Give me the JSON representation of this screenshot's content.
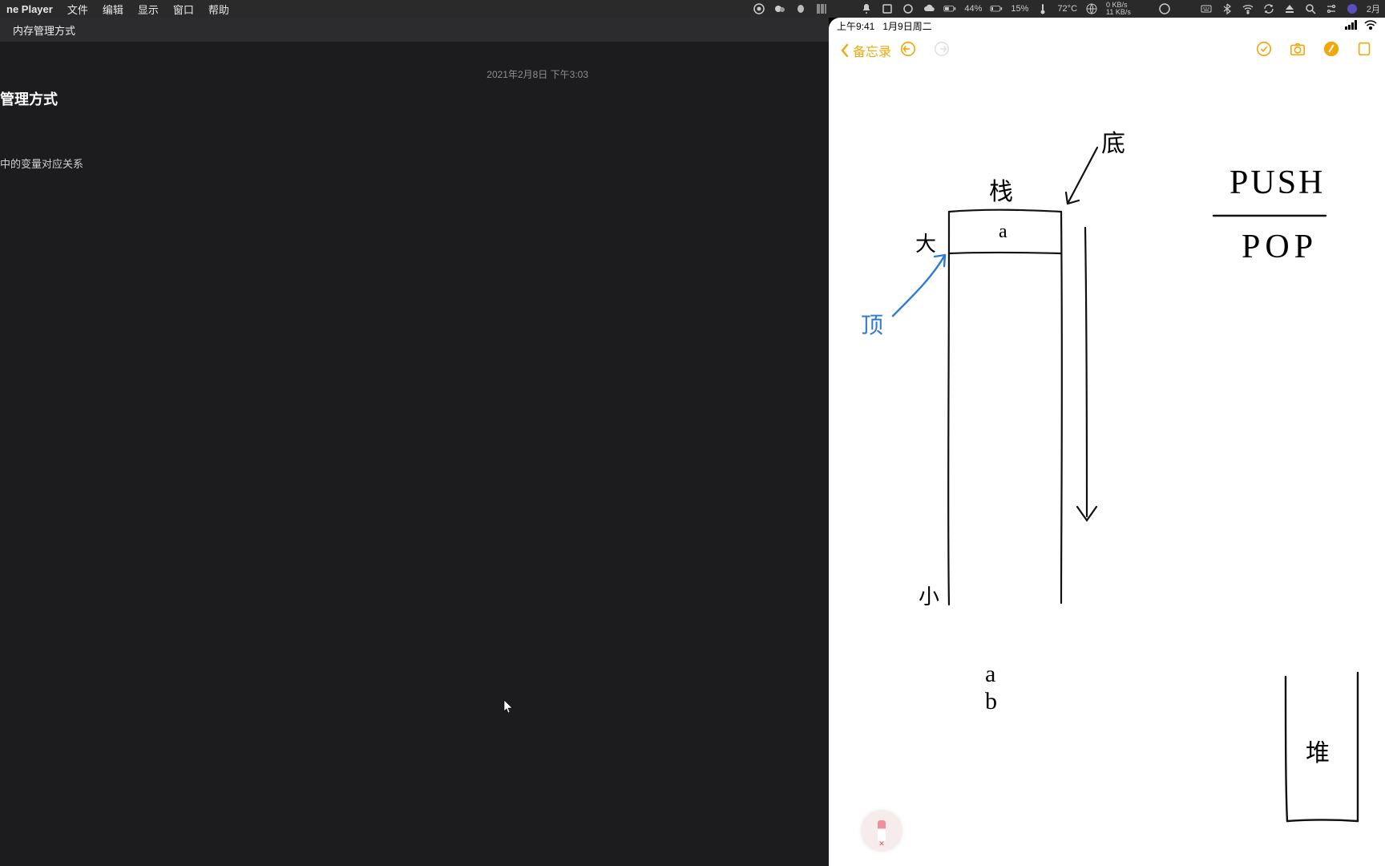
{
  "menubar": {
    "app": "ne Player",
    "items": [
      "文件",
      "编辑",
      "显示",
      "窗口",
      "帮助"
    ],
    "status": {
      "battery1": "44%",
      "battery2": "15%",
      "temp": "72°C",
      "net_up": "0 KB/s",
      "net_dn": "11 KB/s",
      "date": "2月"
    }
  },
  "note_left": {
    "tab": "内存管理方式",
    "timestamp": "2021年2月8日 下午3:03",
    "title": "管理方式",
    "subline": "中的变量对应关系"
  },
  "ipad": {
    "status_time": "上午9:41",
    "status_date": "1月9日周二",
    "back_label": "备忘录"
  },
  "sketch": {
    "top_label": "栈",
    "top_cell": "a",
    "left_big": "大",
    "left_small": "小",
    "blue_label": "顶",
    "right_bottom_label": "底",
    "below": "a  b",
    "right_word1": "PUSH",
    "right_word2": "POP",
    "heap_label": "堆"
  }
}
